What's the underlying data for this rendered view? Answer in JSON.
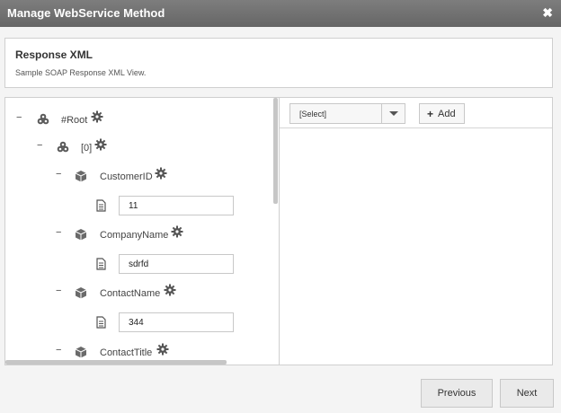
{
  "window": {
    "title": "Manage WebService Method",
    "close_icon": "close-icon"
  },
  "info": {
    "heading": "Response XML",
    "subtitle": "Sample SOAP Response XML View."
  },
  "tree": {
    "collapse_glyph": "−",
    "root": {
      "label": "#Root"
    },
    "item0": {
      "label": "[0]"
    },
    "nodes": [
      {
        "label": "CustomerID",
        "value": "11"
      },
      {
        "label": "CompanyName",
        "value": "sdrfd"
      },
      {
        "label": "ContactName",
        "value": "344"
      },
      {
        "label": "ContactTitle"
      }
    ]
  },
  "toolbar": {
    "select_value": "[Select]",
    "add_icon": "plus-icon",
    "add_label": "Add"
  },
  "footer": {
    "previous_label": "Previous",
    "next_label": "Next"
  }
}
